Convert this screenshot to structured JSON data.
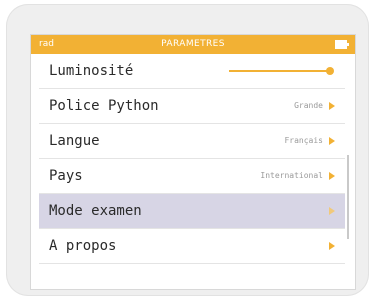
{
  "statusbar": {
    "left": "rad",
    "title": "PARAMETRES"
  },
  "settings": [
    {
      "label": "Luminosité",
      "value": "",
      "level": 1.0
    },
    {
      "label": "Police Python",
      "value": "Grande"
    },
    {
      "label": "Langue",
      "value": "Français"
    },
    {
      "label": "Pays",
      "value": "International"
    },
    {
      "label": "Mode examen",
      "value": ""
    },
    {
      "label": "A propos",
      "value": ""
    }
  ],
  "colors": {
    "accent": "#f2b134",
    "selected": "#d7d5e5"
  },
  "icons": {
    "battery": "battery-icon",
    "arrow": "chevron-right-icon"
  }
}
